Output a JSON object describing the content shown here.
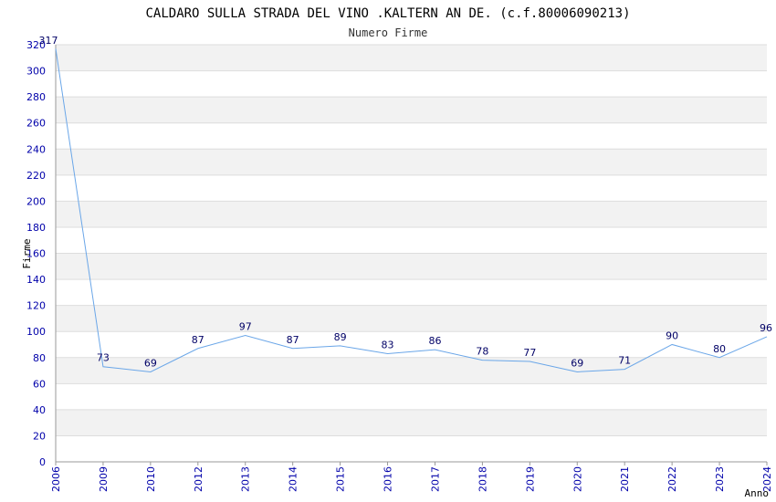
{
  "chart_data": {
    "type": "line",
    "title": "CALDARO SULLA STRADA DEL VINO .KALTERN AN DE. (c.f.80006090213)",
    "subtitle": "Numero Firme",
    "xlabel": "Anno",
    "ylabel": "Firme",
    "categories": [
      "2006",
      "2009",
      "2010",
      "2012",
      "2013",
      "2014",
      "2015",
      "2016",
      "2017",
      "2018",
      "2019",
      "2020",
      "2021",
      "2022",
      "2023",
      "2024"
    ],
    "values": [
      317,
      73,
      69,
      87,
      97,
      87,
      89,
      83,
      86,
      78,
      77,
      69,
      71,
      90,
      80,
      96
    ],
    "ylim": [
      0,
      320
    ],
    "yticks": [
      0,
      20,
      40,
      60,
      80,
      100,
      120,
      140,
      160,
      180,
      200,
      220,
      240,
      260,
      280,
      300,
      320
    ],
    "grid": true,
    "colors": {
      "line": "#6aa6e8",
      "band": "#f2f2f2",
      "grid": "#dddddd",
      "tick": "#0000aa",
      "label": "#000066"
    }
  }
}
